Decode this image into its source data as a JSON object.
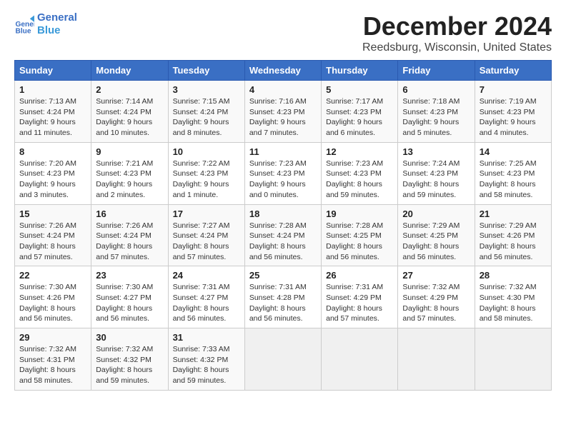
{
  "header": {
    "logo_line1": "General",
    "logo_line2": "Blue",
    "title": "December 2024",
    "subtitle": "Reedsburg, Wisconsin, United States"
  },
  "columns": [
    "Sunday",
    "Monday",
    "Tuesday",
    "Wednesday",
    "Thursday",
    "Friday",
    "Saturday"
  ],
  "weeks": [
    [
      {
        "day": "1",
        "info": "Sunrise: 7:13 AM\nSunset: 4:24 PM\nDaylight: 9 hours\nand 11 minutes."
      },
      {
        "day": "2",
        "info": "Sunrise: 7:14 AM\nSunset: 4:24 PM\nDaylight: 9 hours\nand 10 minutes."
      },
      {
        "day": "3",
        "info": "Sunrise: 7:15 AM\nSunset: 4:24 PM\nDaylight: 9 hours\nand 8 minutes."
      },
      {
        "day": "4",
        "info": "Sunrise: 7:16 AM\nSunset: 4:23 PM\nDaylight: 9 hours\nand 7 minutes."
      },
      {
        "day": "5",
        "info": "Sunrise: 7:17 AM\nSunset: 4:23 PM\nDaylight: 9 hours\nand 6 minutes."
      },
      {
        "day": "6",
        "info": "Sunrise: 7:18 AM\nSunset: 4:23 PM\nDaylight: 9 hours\nand 5 minutes."
      },
      {
        "day": "7",
        "info": "Sunrise: 7:19 AM\nSunset: 4:23 PM\nDaylight: 9 hours\nand 4 minutes."
      }
    ],
    [
      {
        "day": "8",
        "info": "Sunrise: 7:20 AM\nSunset: 4:23 PM\nDaylight: 9 hours\nand 3 minutes."
      },
      {
        "day": "9",
        "info": "Sunrise: 7:21 AM\nSunset: 4:23 PM\nDaylight: 9 hours\nand 2 minutes."
      },
      {
        "day": "10",
        "info": "Sunrise: 7:22 AM\nSunset: 4:23 PM\nDaylight: 9 hours\nand 1 minute."
      },
      {
        "day": "11",
        "info": "Sunrise: 7:23 AM\nSunset: 4:23 PM\nDaylight: 9 hours\nand 0 minutes."
      },
      {
        "day": "12",
        "info": "Sunrise: 7:23 AM\nSunset: 4:23 PM\nDaylight: 8 hours\nand 59 minutes."
      },
      {
        "day": "13",
        "info": "Sunrise: 7:24 AM\nSunset: 4:23 PM\nDaylight: 8 hours\nand 59 minutes."
      },
      {
        "day": "14",
        "info": "Sunrise: 7:25 AM\nSunset: 4:23 PM\nDaylight: 8 hours\nand 58 minutes."
      }
    ],
    [
      {
        "day": "15",
        "info": "Sunrise: 7:26 AM\nSunset: 4:24 PM\nDaylight: 8 hours\nand 57 minutes."
      },
      {
        "day": "16",
        "info": "Sunrise: 7:26 AM\nSunset: 4:24 PM\nDaylight: 8 hours\nand 57 minutes."
      },
      {
        "day": "17",
        "info": "Sunrise: 7:27 AM\nSunset: 4:24 PM\nDaylight: 8 hours\nand 57 minutes."
      },
      {
        "day": "18",
        "info": "Sunrise: 7:28 AM\nSunset: 4:24 PM\nDaylight: 8 hours\nand 56 minutes."
      },
      {
        "day": "19",
        "info": "Sunrise: 7:28 AM\nSunset: 4:25 PM\nDaylight: 8 hours\nand 56 minutes."
      },
      {
        "day": "20",
        "info": "Sunrise: 7:29 AM\nSunset: 4:25 PM\nDaylight: 8 hours\nand 56 minutes."
      },
      {
        "day": "21",
        "info": "Sunrise: 7:29 AM\nSunset: 4:26 PM\nDaylight: 8 hours\nand 56 minutes."
      }
    ],
    [
      {
        "day": "22",
        "info": "Sunrise: 7:30 AM\nSunset: 4:26 PM\nDaylight: 8 hours\nand 56 minutes."
      },
      {
        "day": "23",
        "info": "Sunrise: 7:30 AM\nSunset: 4:27 PM\nDaylight: 8 hours\nand 56 minutes."
      },
      {
        "day": "24",
        "info": "Sunrise: 7:31 AM\nSunset: 4:27 PM\nDaylight: 8 hours\nand 56 minutes."
      },
      {
        "day": "25",
        "info": "Sunrise: 7:31 AM\nSunset: 4:28 PM\nDaylight: 8 hours\nand 56 minutes."
      },
      {
        "day": "26",
        "info": "Sunrise: 7:31 AM\nSunset: 4:29 PM\nDaylight: 8 hours\nand 57 minutes."
      },
      {
        "day": "27",
        "info": "Sunrise: 7:32 AM\nSunset: 4:29 PM\nDaylight: 8 hours\nand 57 minutes."
      },
      {
        "day": "28",
        "info": "Sunrise: 7:32 AM\nSunset: 4:30 PM\nDaylight: 8 hours\nand 58 minutes."
      }
    ],
    [
      {
        "day": "29",
        "info": "Sunrise: 7:32 AM\nSunset: 4:31 PM\nDaylight: 8 hours\nand 58 minutes."
      },
      {
        "day": "30",
        "info": "Sunrise: 7:32 AM\nSunset: 4:32 PM\nDaylight: 8 hours\nand 59 minutes."
      },
      {
        "day": "31",
        "info": "Sunrise: 7:33 AM\nSunset: 4:32 PM\nDaylight: 8 hours\nand 59 minutes."
      },
      null,
      null,
      null,
      null
    ]
  ]
}
